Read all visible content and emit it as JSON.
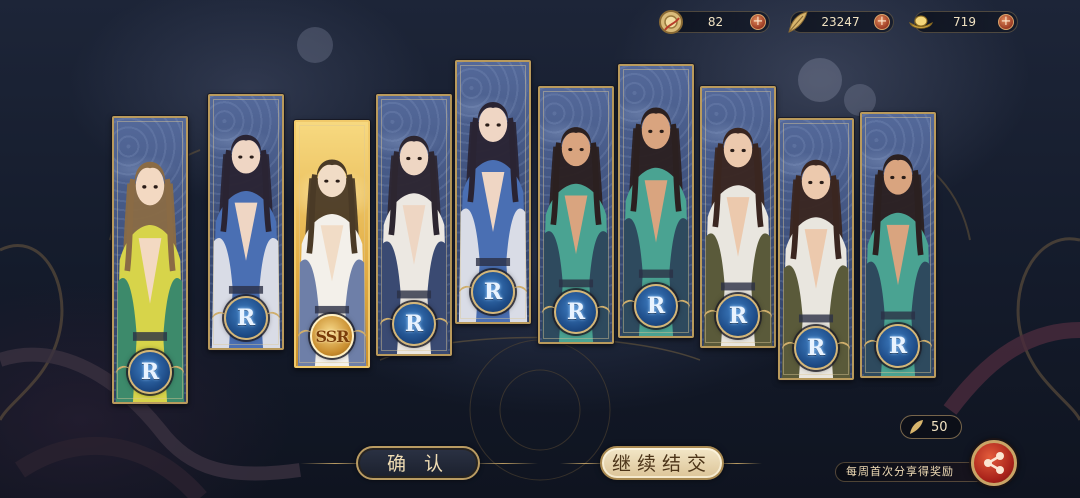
{
  "currencies": [
    {
      "icon": "coin-icon",
      "value": "82"
    },
    {
      "icon": "feather-icon",
      "value": "23247"
    },
    {
      "icon": "gold-ingot-icon",
      "value": "719"
    }
  ],
  "cards": [
    {
      "rarity": "R",
      "character": "green-robed-youth-with-bird"
    },
    {
      "rarity": "R",
      "character": "long-haired-swordsman-blue"
    },
    {
      "rarity": "SSR",
      "character": "white-robed-scholar"
    },
    {
      "rarity": "R",
      "character": "crowned-scholar-white"
    },
    {
      "rarity": "R",
      "character": "long-haired-swordsman-blue"
    },
    {
      "rarity": "R",
      "character": "bearded-man-with-fan"
    },
    {
      "rarity": "R",
      "character": "bearded-man-with-fan"
    },
    {
      "rarity": "R",
      "character": "scarfed-swordsman"
    },
    {
      "rarity": "R",
      "character": "scarfed-swordsman"
    },
    {
      "rarity": "R",
      "character": "bearded-man-with-fan"
    }
  ],
  "buttons": {
    "confirm": "确 认",
    "continue": "继续结交"
  },
  "reward": {
    "icon": "feather-icon",
    "value": "50"
  },
  "share": {
    "text": "每周首次分享得奖励",
    "icon": "share-icon"
  }
}
